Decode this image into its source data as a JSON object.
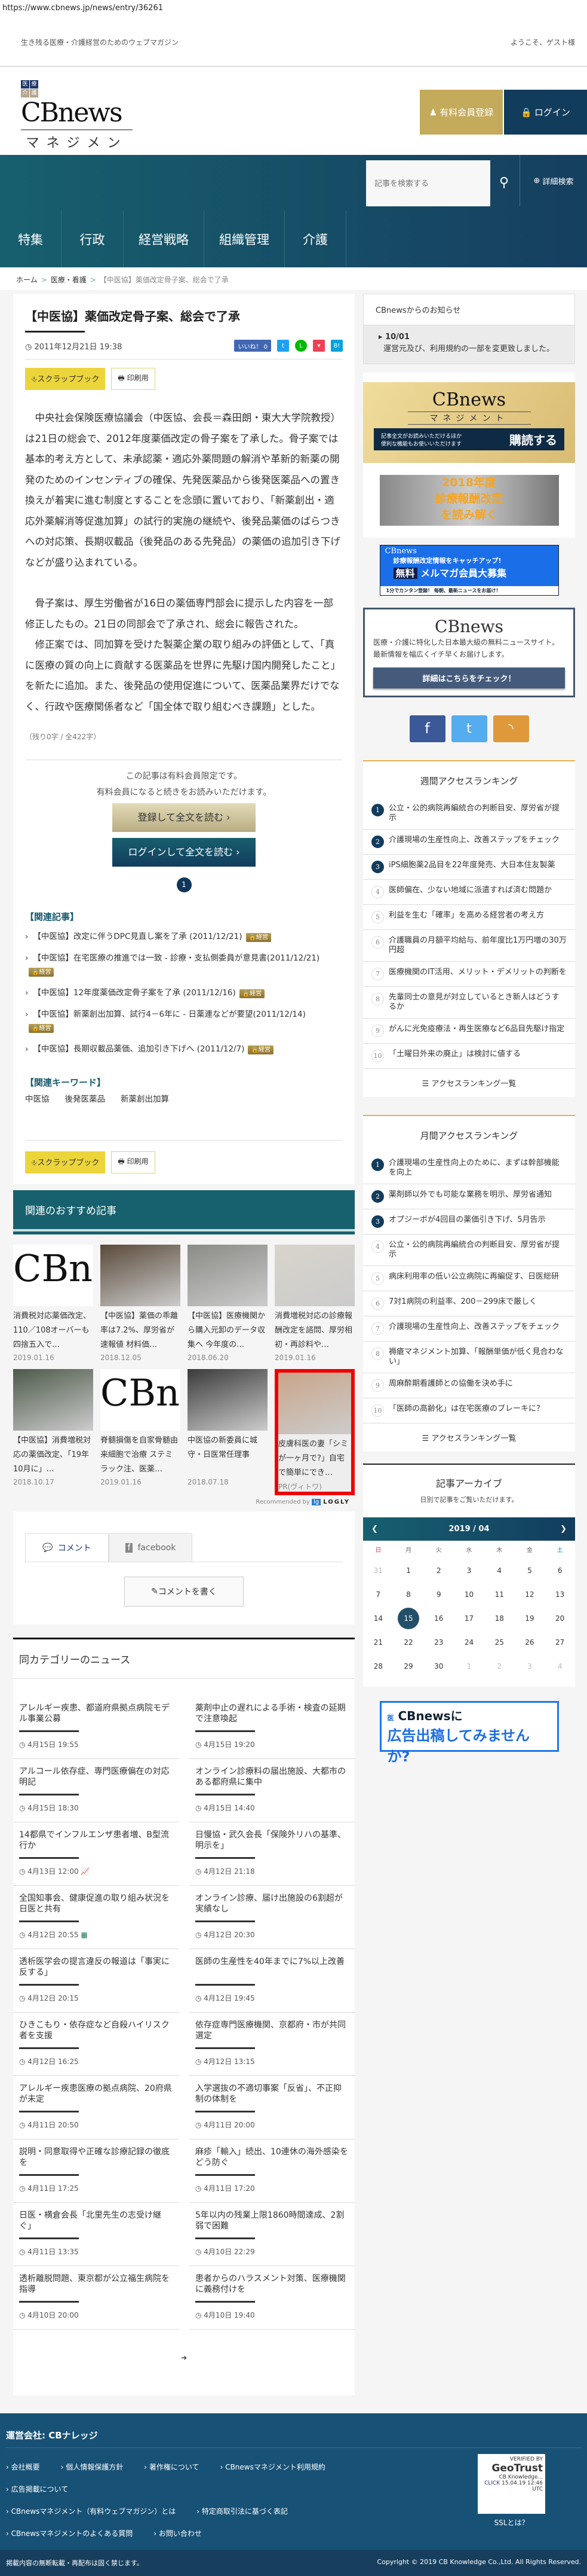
{
  "url": "https://www.cbnews.jp/news/entry/36261",
  "header": {
    "tagline": "生き残る医療・介護経営のためのウェブマガジン",
    "welcome": "ようこそ、ゲスト様",
    "logo": {
      "boxes": [
        "医",
        "療",
        "介",
        "護"
      ],
      "brand": "CBnews",
      "sub": "マネジメント"
    },
    "register": "有料会員登録",
    "login": "ログイン",
    "search_placeholder": "記事を検索する",
    "advanced_search": "詳細検索"
  },
  "nav": [
    "特集",
    "行政",
    "経営戦略",
    "組織管理",
    "介護"
  ],
  "breadcrumb": [
    "ホーム",
    "医療・看護",
    "【中医協】薬価改定骨子案、総会で了承"
  ],
  "article": {
    "title": "【中医協】薬価改定骨子案、総会で了承",
    "date": "2011年12月21日 19:38",
    "like": "いいね！ 0",
    "scrapbook": "スクラップブック",
    "print": "印刷用",
    "paragraphs": [
      "中央社会保険医療協議会（中医協、会長＝森田朗・東大大学院教授）は21日の総会で、2012年度薬価改定の骨子案を了承した。骨子案では基本的考え方として、未承認薬・適応外薬問題の解消や革新的新薬の開発のためのインセンティブの確保、先発医薬品から後発医薬品への置き換えが着実に進む制度とすることを念頭に置いており、「新薬創出・適応外薬解消等促進加算」の試行的実施の継続や、後発品薬価のばらつきへの対応策、長期収載品（後発品のある先発品）の薬価の追加引き下げなどが盛り込まれている。",
      "骨子案は、厚生労働省が16日の薬価専門部会に提示した内容を一部修正したもの。21日の同部会で了承され、総会に報告された。",
      "修正案では、同加算を受けた製薬企業の取り組みの評価として、「真に医療の質の向上に貢献する医薬品を世界に先駆け国内開発したこと」を新たに追加。また、後発品の使用促進について、医薬品業界だけでなく、行政や医療関係者など「国全体で取り組むべき課題」とした。"
    ],
    "remaining": "（残り0字 / 全422字）",
    "paywall": [
      "この記事は有料会員限定です。",
      "有料会員になると続きをお読みいただけます。"
    ],
    "register_read": "登録して全文を読む ›",
    "login_read": "ログインして全文を読む ›",
    "page": "1",
    "related_title": "【関連記事】",
    "lock_label": "経営",
    "related": [
      "【中医協】改定に伴うDPC見直し案を了承 (2011/12/21)",
      "【中医協】在宅医療の推進では一致 - 診療・支払側委員が意見書(2011/12/21)",
      "【中医協】12年度薬価改定骨子案を了承 (2011/12/16)",
      "【中医協】新薬創出加算、試行4－6年に - 日薬連などが要望(2011/12/14)",
      "【中医協】長期収載品薬価、追加引き下げへ (2011/12/7)"
    ],
    "keywords_title": "【関連キーワード】",
    "keywords": [
      "中医協",
      "後発医薬品",
      "新薬創出加算"
    ]
  },
  "recommend": {
    "title": "関連のおすすめ記事",
    "items": [
      {
        "t": "消費税対応薬価改定、110／108オーバーも 四捨五入で…",
        "d": "2019.01.16",
        "img": "logo"
      },
      {
        "t": "【中医協】薬価の乖離率は7.2%、厚労省が速報値 材料価…",
        "d": "2018.12.05",
        "img": "#5a4a3a"
      },
      {
        "t": "【中医協】医療機関から購入元卸のデータ収集へ 今年度の…",
        "d": "2018.06.20",
        "img": "#8a8a86"
      },
      {
        "t": "消費増税対応の診療報酬改定を諮問、厚労相 初・再診料や…",
        "d": "2019.01.16",
        "img": "#d8d4cc"
      },
      {
        "t": "【中医協】消費増税対応の薬価改定、「19年10月に」…",
        "d": "2018.10.17",
        "img": "#4d5a4a"
      },
      {
        "t": "脊髄損傷を自家骨髄由来細胞で治療 ステミラック注、医薬…",
        "d": "2019.01.16",
        "img": "logo"
      },
      {
        "t": "中医協の新委員に城守・日医常任理事",
        "d": "2018.07.18",
        "img": "#3a3a3a"
      },
      {
        "t": "皮膚科医の妻「シミが一ヶ月で?」自宅で簡単にでき…",
        "d": "PR(ヴィトワ)",
        "img": "#c9a58a",
        "ad": true
      }
    ],
    "recommended_by": "Recommended by",
    "logly": "LOGLY"
  },
  "comments": {
    "tab_comment": "コメント",
    "tab_facebook": "facebook",
    "write": "コメントを書く"
  },
  "news": {
    "title": "同カテゴリーのニュース",
    "items": [
      {
        "t": "アレルギー疾患、都道府県拠点病院モデル事業公募",
        "d": "4月15日 19:55"
      },
      {
        "t": "薬剤中止の遅れによる手術・検査の延期で注意喚起",
        "d": "4月15日 19:20"
      },
      {
        "t": "アルコール依存症、専門医療偏在の対応明記",
        "d": "4月15日 18:30"
      },
      {
        "t": "オンライン診療料の届出施設、大都市のある都府県に集中",
        "d": "4月15日 14:40"
      },
      {
        "t": "14都県でインフルエンザ患者増、B型流行か",
        "d": "4月13日 12:00",
        "icon": "chart"
      },
      {
        "t": "日慢協・武久会長「保険外リハの基準、明示を」",
        "d": "4月12日 21:18"
      },
      {
        "t": "全国知事会、健康促進の取り組み状況を日医と共有",
        "d": "4月12日 20:55",
        "icon": "table"
      },
      {
        "t": "オンライン診療、届け出施設の6割超が実績なし",
        "d": "4月12日 20:30"
      },
      {
        "t": "透析医学会の提言違反の報道は「事実に反する」",
        "d": "4月12日 20:15"
      },
      {
        "t": "医師の生産性を40年までに7%以上改善",
        "d": "4月12日 19:45"
      },
      {
        "t": "ひきこもり・依存症など自殺ハイリスク者を支援",
        "d": "4月12日 16:25"
      },
      {
        "t": "依存症専門医療機関、京都府・市が共同選定",
        "d": "4月12日 13:15"
      },
      {
        "t": "アレルギー疾患医療の拠点病院、20府県が未定",
        "d": "4月11日 20:50"
      },
      {
        "t": "入学選抜の不適切事案「反省」、不正抑制の体制を",
        "d": "4月11日 20:00"
      },
      {
        "t": "説明・同意取得や正確な診療記録の徹底を",
        "d": "4月11日 17:25"
      },
      {
        "t": "麻疹「輸入」続出、10連休の海外感染をどう防ぐ",
        "d": "4月11日 17:20"
      },
      {
        "t": "日医・横倉会長「北里先生の志受け継ぐ」",
        "d": "4月11日 13:35"
      },
      {
        "t": "5年以内の残業上限1860時間達成、2割弱で困難",
        "d": "4月10日 22:29"
      },
      {
        "t": "透析離脱問題、東京都が公立福生病院を指導",
        "d": "4月10日 20:00"
      },
      {
        "t": "患者からのハラスメント対策、医療機関に義務付けを",
        "d": "4月10日 19:40"
      }
    ]
  },
  "sidebar": {
    "notice_title": "CBnewsからのお知らせ",
    "notice_date": "10/01",
    "notice_text": "運営元及び、利用規約の一部を変更致しました。",
    "sub_banner": {
      "text1": "記事全文がお読みいただけるほか",
      "text2": "便利な機能もお使いいただけます",
      "cta": "購読する"
    },
    "kaitei_banner": [
      "2018年度",
      "診療報酬改定",
      "を読み解く"
    ],
    "mail_banner": {
      "brand": "CBnews",
      "l1": "診療報酬改定情報をキャッチアップ!",
      "free": "無料",
      "l2": "メルマガ会員大募集",
      "l3": "1分でカンタン登録！ 毎朝、最新ニュースをお届け！"
    },
    "cbbox": {
      "text": "医療・介護に特化した日本最大級の無料ニュースサイト。最新情報を幅広くイチ早くお届けします。",
      "btn": "詳細はこちらをチェック！"
    },
    "weekly_title": "週間アクセスランキング",
    "weekly": [
      "公立・公的病院再編統合の判断目安、厚労省が提示",
      "介護現場の生産性向上、改善ステップをチェック",
      "iPS細胞薬2品目を22年度発売、大日本住友製薬",
      "医師偏在、少ない地域に派遣すれば済む問題か",
      "利益を生む「確率」を高める経営者の考え方",
      "介護職員の月額平均給与、前年度比1万円増の30万円超",
      "医療機関のIT活用、メリット・デメリットの判断を",
      "先輩同士の意見が対立しているとき新人はどうするか",
      "がんに光免疫療法・再生医療など6品目先駆け指定",
      "「土曜日外来の廃止」は検討に値する"
    ],
    "monthly_title": "月間アクセスランキング",
    "monthly": [
      "介護現場の生産性向上のために、まずは幹部機能を向上",
      "薬剤師以外でも可能な業務を明示、厚労省通知",
      "オプジーボが4回目の薬価引き下げ、5月告示",
      "公立・公的病院再編統合の判断目安、厚労省が提示",
      "病床利用率の低い公立病院に再編促す、日医総研",
      "7対1病院の利益率、200－299床で厳しく",
      "介護現場の生産性向上、改善ステップをチェック",
      "褥瘡マネジメント加算、「報酬単価が低く見合わない」",
      "周麻酔期看護師との協働を決め手に",
      "「医師の高齢化」は在宅医療のブレーキに？"
    ],
    "ranking_all": "アクセスランキング一覧",
    "archive_title": "記事アーカイブ",
    "archive_sub": "日別で記事をご覧いただけます。",
    "month": "2019 / 04",
    "weekdays": [
      "日",
      "月",
      "火",
      "水",
      "木",
      "金",
      "土"
    ],
    "days": [
      "31",
      "1",
      "2",
      "3",
      "4",
      "5",
      "6",
      "7",
      "8",
      "9",
      "10",
      "11",
      "12",
      "13",
      "14",
      "15",
      "16",
      "17",
      "18",
      "19",
      "20",
      "21",
      "22",
      "23",
      "24",
      "25",
      "26",
      "27",
      "28",
      "29",
      "30",
      "1",
      "2",
      "3",
      "4"
    ],
    "selected_day": "15",
    "ad_banner": {
      "l1": "CBnewsに",
      "l2": "広告出稿してみませんか?"
    }
  },
  "footer": {
    "company": "運営会社: CBナレッジ",
    "links": [
      "会社概要",
      "個人情報保護方針",
      "著作権について",
      "CBnewsマネジメント利用規約",
      "広告掲載について",
      "CBnewsマネジメント（有料ウェブマガジン）とは",
      "特定商取引法に基づく表記",
      "CBnewsマネジメントのよくある質問",
      "お問い合わせ"
    ],
    "ssl": {
      "verified": "VERIFIED BY",
      "brand": "GeoTrust",
      "org": "CB Knowledge...",
      "click": "CLICK",
      "time": "15.04.19 12:46 UTC",
      "what": "SSLとは？"
    },
    "notice": "掲載内容の無断転載・再配布は固く禁じます。",
    "copyright": "Copyright © 2019 CB Knowledge Co.,Ltd. All Rights Reserved."
  },
  "colors": {
    "teal": "#17616e",
    "navy": "#123c5c",
    "gold": "#c4aa5b",
    "scrap": "#ecd43b",
    "footer": "#185176"
  }
}
